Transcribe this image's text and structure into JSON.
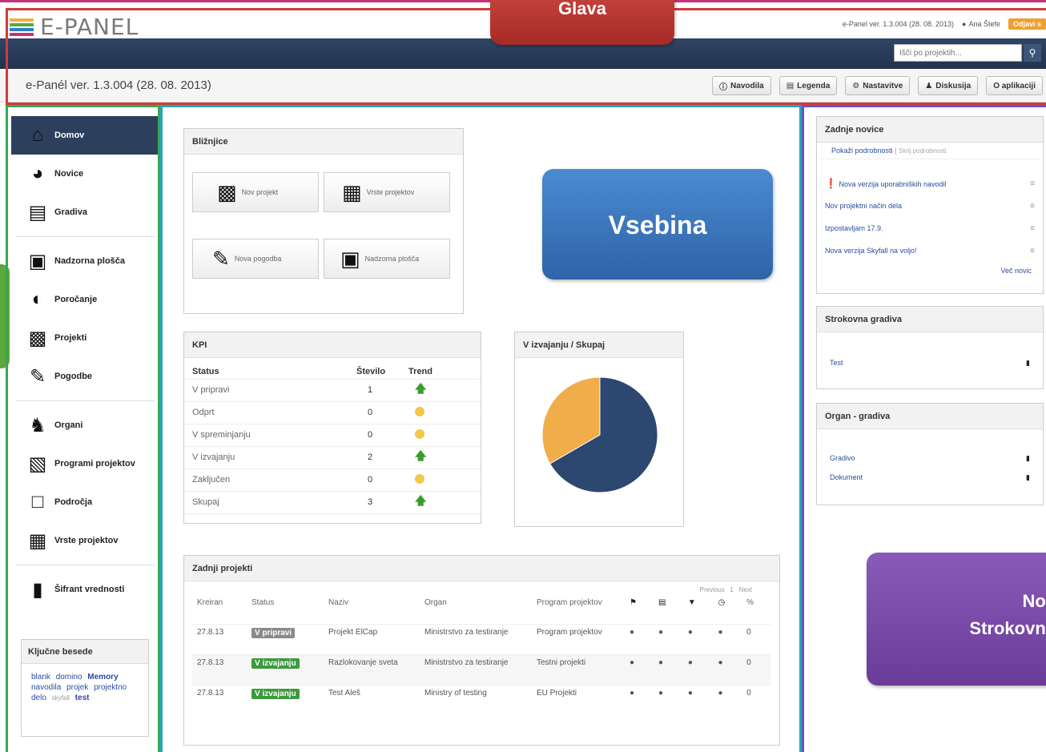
{
  "app": {
    "logo_text": "E-PANEL",
    "version_info": "e-Panel ver. 1.3.004 (28. 08. 2013)",
    "user_name": "Ana Štefe",
    "logout_label": "Odjavi s",
    "search_placeholder": "Išči po projektih...",
    "version_text": "e-Panél ver. 1.3.004 (28. 08. 2013)"
  },
  "toolbar": {
    "buttons": [
      {
        "label": "Navodila",
        "icon": "circle-info-icon"
      },
      {
        "label": "Legenda",
        "icon": "list-icon"
      },
      {
        "label": "Nastavitve",
        "icon": "gear-icon"
      },
      {
        "label": "Diskusija",
        "icon": "people-icon"
      },
      {
        "label": "O aplikaciji",
        "icon": ""
      }
    ]
  },
  "sidebar": {
    "items": [
      {
        "label": "Domov",
        "icon": "home-icon",
        "active": true
      },
      {
        "label": "Novice",
        "icon": "globe-icon"
      },
      {
        "label": "Gradiva",
        "icon": "document-icon"
      },
      {
        "label": "Nadzorna plošča",
        "icon": "chart-board-icon"
      },
      {
        "label": "Poročanje",
        "icon": "gauge-icon"
      },
      {
        "label": "Projekti",
        "icon": "briefcase-icon"
      },
      {
        "label": "Pogodbe",
        "icon": "pen-icon"
      },
      {
        "label": "Organi",
        "icon": "person-tie-icon"
      },
      {
        "label": "Programi projektov",
        "icon": "archive-icon"
      },
      {
        "label": "Področja",
        "icon": "square-icon"
      },
      {
        "label": "Vrste projektov",
        "icon": "grid-icon"
      },
      {
        "label": "Šifrant vrednosti",
        "icon": "clipboard-icon"
      }
    ],
    "keywords": {
      "title": "Ključne besede",
      "words": [
        "blank",
        "domino",
        "Memory",
        "navodila",
        "projek",
        "projektno delo",
        "skyfall",
        "test"
      ]
    }
  },
  "shortcuts": {
    "title": "Bližnjice",
    "items": [
      {
        "label": "Nov projekt",
        "icon": "briefcase-icon"
      },
      {
        "label": "Vrste projektov",
        "icon": "grid-icon"
      },
      {
        "label": "Nova pogodba",
        "icon": "pen-icon"
      },
      {
        "label": "Nadzorna plošča",
        "icon": "chart-board-icon"
      }
    ]
  },
  "kpi": {
    "title": "KPI",
    "headers": [
      "Status",
      "Število",
      "Trend"
    ],
    "rows": [
      {
        "status": "V pripravi",
        "count": "1",
        "trend": "up"
      },
      {
        "status": "Odprt",
        "count": "0",
        "trend": "neutral"
      },
      {
        "status": "V spreminjanju",
        "count": "0",
        "trend": "neutral"
      },
      {
        "status": "V izvajanju",
        "count": "2",
        "trend": "up"
      },
      {
        "status": "Zaključen",
        "count": "0",
        "trend": "neutral"
      },
      {
        "status": "Skupaj",
        "count": "3",
        "trend": "up"
      }
    ]
  },
  "pie": {
    "title": "V izvajanju / Skupaj",
    "slices": [
      {
        "value": 2,
        "color": "#2c4770"
      },
      {
        "value": 1,
        "color": "#f2ad4b"
      }
    ]
  },
  "projects": {
    "title": "Zadnji projekti",
    "pager": {
      "previous": "Previous",
      "page": "1",
      "next": "Next"
    },
    "headers": [
      "Kreiran",
      "Status",
      "Naziv",
      "Organ",
      "Program projektov",
      "",
      "",
      "",
      "",
      "%"
    ],
    "rows": [
      {
        "created": "27.8.13",
        "status": "V pripravi",
        "status_color": "#8a8a8a",
        "name": "Projekt ElCap",
        "organ": "Ministrstvo za testiranje",
        "program": "Program projektov",
        "percent": "0"
      },
      {
        "created": "27.8.13",
        "status": "V izvajanju",
        "status_color": "#3c9a3c",
        "name": "Razlokovanje sveta",
        "organ": "Ministrstvo za testiranje",
        "program": "Testni projekti",
        "percent": "0"
      },
      {
        "created": "27.8.13",
        "status": "V izvajanju",
        "status_color": "#3c9a3c",
        "name": "Test Aleš",
        "organ": "Ministry of testing",
        "program": "EU Projekti",
        "percent": "0"
      }
    ]
  },
  "news": {
    "title": "Zadnje novice",
    "show_details": "Pokaži podrobnosti",
    "hide_details": "Skrij podrobnosti",
    "items": [
      "Nova verzija uporabniških navodil",
      "Nov projektni način dela",
      "Izpostavljam 17.9.",
      "Nova verzija Skyfall na voljo!"
    ],
    "more": "Več novic"
  },
  "expert_materials": {
    "title": "Strokovna gradiva",
    "items": [
      "Test"
    ]
  },
  "organ_materials": {
    "title": "Organ - gradiva",
    "items": [
      "Gradivo",
      "Dokument"
    ]
  },
  "callouts": {
    "header": "Glava",
    "content": "Vsebina",
    "right_line1": "Nov",
    "right_line2": "Strokovna"
  }
}
